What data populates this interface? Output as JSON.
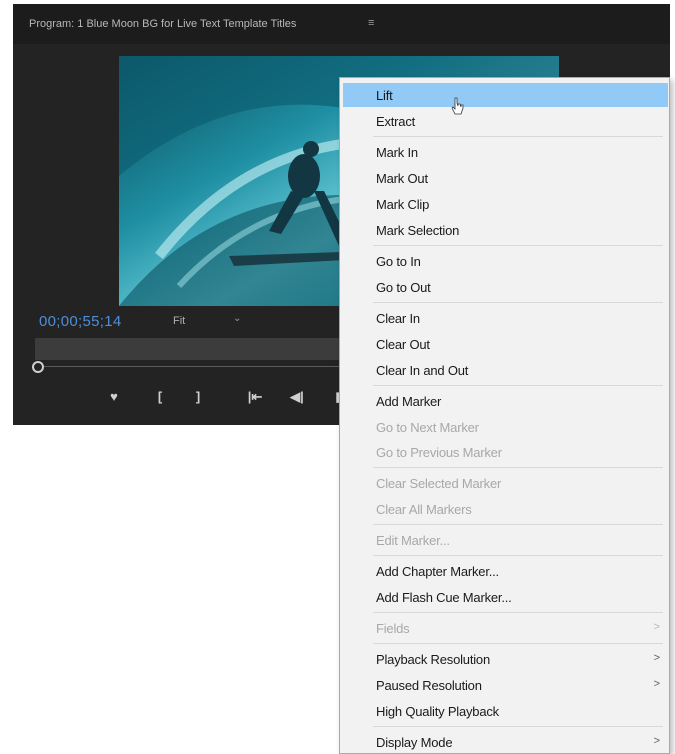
{
  "monitor": {
    "title": "Program: 1 Blue Moon BG for Live Text Template Titles",
    "menu_icon": "≡",
    "timecode": "00;00;55;14",
    "fit": "Fit",
    "fit_chevron": "⌄",
    "transport": {
      "marker": "♥",
      "mark_in": "[",
      "mark_out": "]",
      "go_to_in": "|⇤",
      "step_back": "◀|",
      "play": "▮"
    }
  },
  "context_menu": {
    "items": [
      {
        "label": "Lift",
        "highlighted": true
      },
      {
        "label": "Extract"
      },
      {
        "label": "Mark In"
      },
      {
        "label": "Mark Out"
      },
      {
        "label": "Mark Clip"
      },
      {
        "label": "Mark Selection"
      },
      {
        "label": "Go to In"
      },
      {
        "label": "Go to Out"
      },
      {
        "label": "Clear In"
      },
      {
        "label": "Clear Out"
      },
      {
        "label": "Clear In and Out"
      },
      {
        "label": "Add Marker"
      },
      {
        "label": "Go to Next Marker",
        "disabled": true
      },
      {
        "label": "Go to Previous Marker",
        "disabled": true
      },
      {
        "label": "Clear Selected Marker",
        "disabled": true
      },
      {
        "label": "Clear All Markers",
        "disabled": true
      },
      {
        "label": "Edit Marker...",
        "disabled": true
      },
      {
        "label": "Add Chapter Marker..."
      },
      {
        "label": "Add Flash Cue Marker..."
      },
      {
        "label": "Fields",
        "disabled": true,
        "submenu": true
      },
      {
        "label": "Playback Resolution",
        "submenu": true
      },
      {
        "label": "Paused Resolution",
        "submenu": true
      },
      {
        "label": "High Quality Playback"
      },
      {
        "label": "Display Mode",
        "submenu": true
      }
    ],
    "submenu_arrow": ">"
  },
  "colors": {
    "highlight": "#91c9f7",
    "timecode": "#4e8fd8",
    "panel": "#232323"
  }
}
